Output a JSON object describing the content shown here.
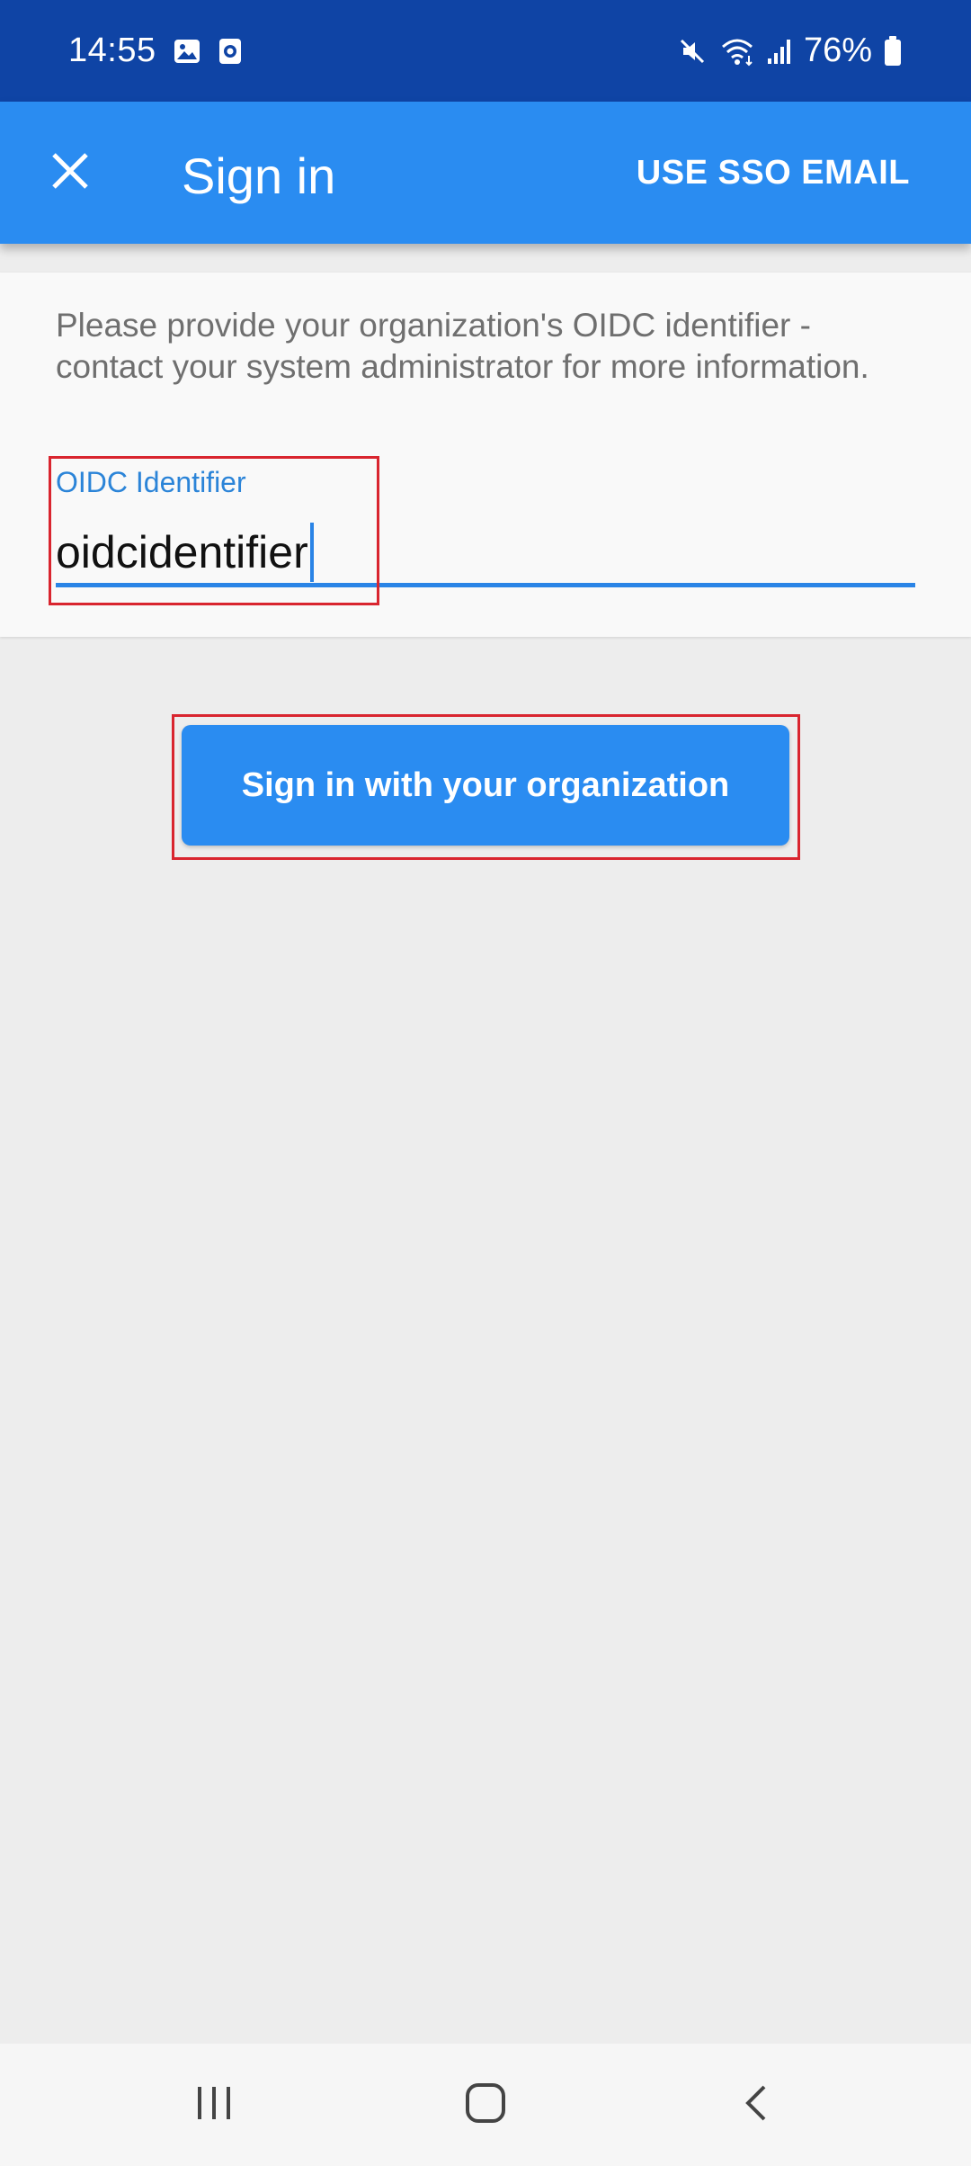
{
  "status_bar": {
    "time": "14:55",
    "battery": "76%",
    "icons": [
      "gallery-icon",
      "screen-recorder-icon",
      "mute-icon",
      "wifi-icon",
      "signal-icon",
      "battery-icon"
    ]
  },
  "app_bar": {
    "title": "Sign in",
    "action_label": "USE SSO EMAIL",
    "close_icon": "close-icon"
  },
  "form": {
    "info": "Please provide your organization's OIDC identifier - contact your system administrator for more information.",
    "field_label": "OIDC Identifier",
    "field_value": "oidcidentifier"
  },
  "primary_button": {
    "label": "Sign in with your organization"
  },
  "nav_bar": {
    "icons": [
      "recents-icon",
      "home-icon",
      "back-icon"
    ]
  },
  "colors": {
    "status_bar": "#0f44a5",
    "app_bar": "#2a8cf1",
    "accent": "#2a84e6",
    "highlight": "#d9252f",
    "background": "#ededed"
  }
}
